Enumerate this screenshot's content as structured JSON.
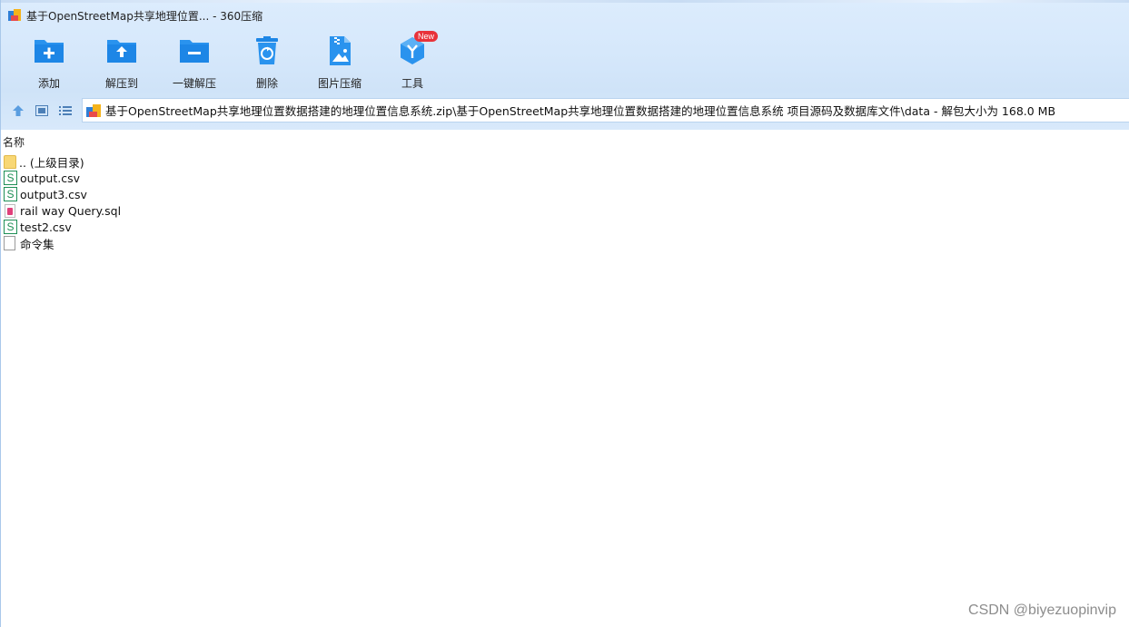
{
  "window": {
    "title": "基于OpenStreetMap共享地理位置... - 360压缩"
  },
  "toolbar": {
    "items": [
      {
        "label": "添加",
        "icon": "folder-add-icon"
      },
      {
        "label": "解压到",
        "icon": "folder-extract-icon"
      },
      {
        "label": "一键解压",
        "icon": "folder-quick-extract-icon"
      },
      {
        "label": "删除",
        "icon": "trash-recycle-icon"
      },
      {
        "label": "图片压缩",
        "icon": "image-compress-icon"
      },
      {
        "label": "工具",
        "icon": "tools-cube-icon",
        "badge": "New"
      }
    ]
  },
  "address": {
    "path": "基于OpenStreetMap共享地理位置数据搭建的地理位置信息系统.zip\\基于OpenStreetMap共享地理位置数据搭建的地理位置信息系统 项目源码及数据库文件\\data - 解包大小为 168.0 MB"
  },
  "filelist": {
    "column_name": "名称",
    "rows": [
      {
        "name": ".. (上级目录)",
        "type": "folder"
      },
      {
        "name": "output.csv",
        "type": "csv"
      },
      {
        "name": "output3.csv",
        "type": "csv"
      },
      {
        "name": "rail way Query.sql",
        "type": "sql"
      },
      {
        "name": "test2.csv",
        "type": "csv"
      },
      {
        "name": "命令集",
        "type": "file"
      }
    ]
  },
  "colors": {
    "accent": "#1d8bea",
    "header_bg": "#d6e8fb",
    "badge": "#e8323a",
    "csv_green": "#1e8f55"
  },
  "watermark": "CSDN @biyezuopinvip"
}
